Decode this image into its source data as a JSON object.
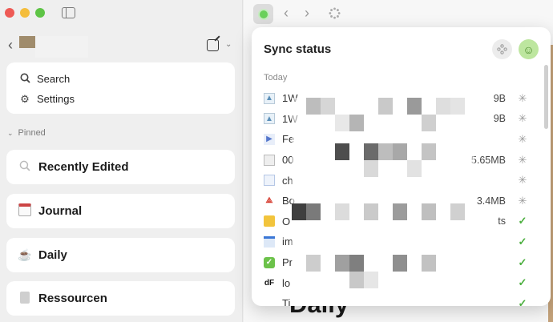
{
  "sidebar": {
    "menu": [
      {
        "label": "Search",
        "icon": "search-icon"
      },
      {
        "label": "Settings",
        "icon": "gear-icon"
      }
    ],
    "pinned_label": "Pinned",
    "pinned": [
      {
        "label": "Recently Edited",
        "icon": "search-icon"
      },
      {
        "label": "Journal",
        "icon": "calendar-icon"
      },
      {
        "label": "Daily",
        "icon": "coffee-icon"
      },
      {
        "label": "Ressourcen",
        "icon": "document-icon"
      }
    ]
  },
  "main": {
    "page_title": "Daily"
  },
  "sync": {
    "title": "Sync status",
    "section": "Today",
    "files": [
      {
        "name": "1W",
        "size": "9B",
        "status": "syncing",
        "type": "image"
      },
      {
        "name": "1W",
        "size": "9B",
        "status": "syncing",
        "type": "image"
      },
      {
        "name": "Fe",
        "size": "",
        "status": "syncing",
        "type": "video"
      },
      {
        "name": "00",
        "size": "5.65MB",
        "status": "syncing",
        "type": "archive"
      },
      {
        "name": "ch",
        "size": "",
        "status": "syncing",
        "type": "document"
      },
      {
        "name": "Bo",
        "size": "3.4MB",
        "status": "syncing",
        "type": "pdf"
      },
      {
        "name": "O",
        "size": "ts",
        "status": "done",
        "type": "folder"
      },
      {
        "name": "im",
        "size": "",
        "status": "done",
        "type": "web"
      },
      {
        "name": "Pr",
        "size": "",
        "status": "done",
        "type": "checkbox"
      },
      {
        "name": "lo",
        "size": "",
        "status": "done",
        "type": "logo"
      },
      {
        "name": "Ti",
        "size": "",
        "status": "done",
        "type": "text"
      }
    ]
  },
  "colors": {
    "accent_green": "#6ad05a",
    "check_green": "#4caf3f",
    "sidebar_bg": "#efefef"
  }
}
